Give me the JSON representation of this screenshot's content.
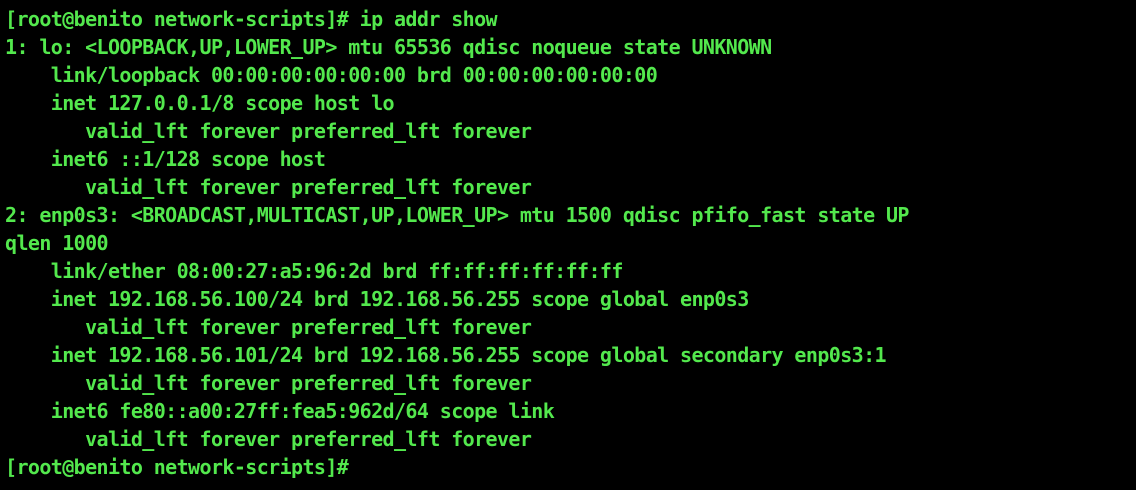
{
  "terminal": {
    "text_color": "#53e84d",
    "background_color": "#000000",
    "lines": [
      "[root@benito network-scripts]# ip addr show",
      "1: lo: <LOOPBACK,UP,LOWER_UP> mtu 65536 qdisc noqueue state UNKNOWN",
      "    link/loopback 00:00:00:00:00:00 brd 00:00:00:00:00:00",
      "    inet 127.0.0.1/8 scope host lo",
      "       valid_lft forever preferred_lft forever",
      "    inet6 ::1/128 scope host",
      "       valid_lft forever preferred_lft forever",
      "2: enp0s3: <BROADCAST,MULTICAST,UP,LOWER_UP> mtu 1500 qdisc pfifo_fast state UP",
      "qlen 1000",
      "    link/ether 08:00:27:a5:96:2d brd ff:ff:ff:ff:ff:ff",
      "    inet 192.168.56.100/24 brd 192.168.56.255 scope global enp0s3",
      "       valid_lft forever preferred_lft forever",
      "    inet 192.168.56.101/24 brd 192.168.56.255 scope global secondary enp0s3:1",
      "       valid_lft forever preferred_lft forever",
      "    inet6 fe80::a00:27ff:fea5:962d/64 scope link",
      "       valid_lft forever preferred_lft forever",
      "[root@benito network-scripts]#"
    ]
  }
}
